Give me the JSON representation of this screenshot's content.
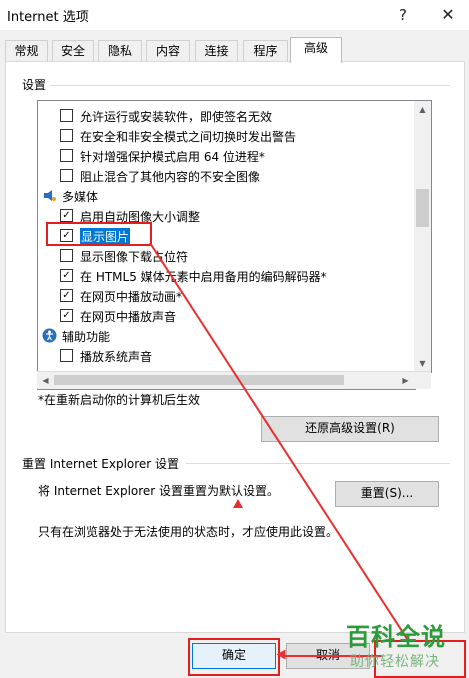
{
  "window": {
    "title": "Internet 选项",
    "help_glyph": "?",
    "close_glyph": "✕"
  },
  "tabs": [
    {
      "label": "常规"
    },
    {
      "label": "安全"
    },
    {
      "label": "隐私"
    },
    {
      "label": "内容"
    },
    {
      "label": "连接"
    },
    {
      "label": "程序"
    },
    {
      "label": "高级",
      "active": true
    }
  ],
  "settings": {
    "group_label": "设置",
    "items": [
      {
        "type": "check",
        "checked": false,
        "label": "允许运行或安装软件，即使签名无效"
      },
      {
        "type": "check",
        "checked": false,
        "label": "在安全和非安全模式之间切换时发出警告"
      },
      {
        "type": "check",
        "checked": false,
        "label": "针对增强保护模式启用 64 位进程*"
      },
      {
        "type": "check",
        "checked": false,
        "label": "阻止混合了其他内容的不安全图像"
      },
      {
        "type": "category",
        "icon": "multimedia-icon",
        "label": "多媒体"
      },
      {
        "type": "check",
        "checked": true,
        "label": "启用自动图像大小调整"
      },
      {
        "type": "check",
        "checked": true,
        "label": "显示图片",
        "selected": true
      },
      {
        "type": "check",
        "checked": false,
        "label": "显示图像下载占位符"
      },
      {
        "type": "check",
        "checked": true,
        "label": "在 HTML5 媒体元素中启用备用的编码解码器*"
      },
      {
        "type": "check",
        "checked": true,
        "label": "在网页中播放动画*"
      },
      {
        "type": "check",
        "checked": true,
        "label": "在网页中播放声音"
      },
      {
        "type": "category",
        "icon": "accessibility-icon",
        "label": "辅助功能"
      },
      {
        "type": "check",
        "checked": false,
        "label": "播放系统声音"
      }
    ],
    "restart_note": "*在重新启动你的计算机后生效",
    "restore_button": "还原高级设置(R)"
  },
  "reset": {
    "group_label": "重置 Internet Explorer 设置",
    "description": "将 Internet Explorer 设置重置为默认设置。",
    "reset_button": "重置(S)...",
    "warning": "只有在浏览器处于无法使用的状态时，才应使用此设置。"
  },
  "footer": {
    "ok_button": "确定",
    "cancel_button": "取消"
  },
  "watermark": {
    "title": "百科全说",
    "subtitle": "助你轻松解决"
  },
  "colors": {
    "annotation_red": "#e02020",
    "selection_blue": "#0078d7",
    "watermark_green": "#2c9b3a"
  }
}
